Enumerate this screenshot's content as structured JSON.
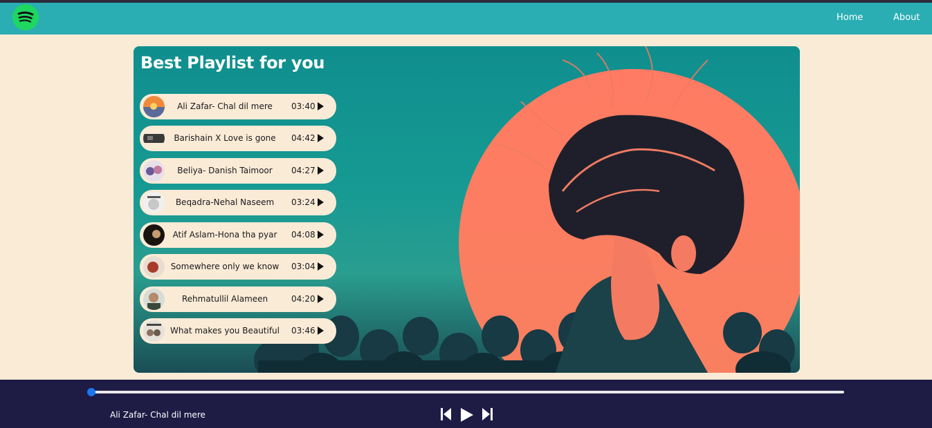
{
  "nav": {
    "logo_icon": "spotify-logo-icon",
    "home": "Home",
    "about": "About"
  },
  "playlist": {
    "heading": "Best Playlist for you",
    "songs": [
      {
        "title": "Ali Zafar- Chal dil mere",
        "duration": "03:40"
      },
      {
        "title": "Barishain X Love is gone",
        "duration": "04:42"
      },
      {
        "title": "Beliya- Danish Taimoor",
        "duration": "04:27"
      },
      {
        "title": "Beqadra-Nehal Naseem",
        "duration": "03:24"
      },
      {
        "title": "Atif Aslam-Hona tha pyar",
        "duration": "04:08"
      },
      {
        "title": "Somewhere only we know",
        "duration": "03:04"
      },
      {
        "title": "Rehmatullil Alameen",
        "duration": "04:20"
      },
      {
        "title": "What makes you Beautiful",
        "duration": "03:46"
      }
    ]
  },
  "player": {
    "now_playing": "Ali Zafar- Chal dil mere",
    "progress": 0,
    "icons": [
      "previous-icon",
      "play-icon",
      "next-icon"
    ]
  },
  "colors": {
    "navbar": "#2aaeb3",
    "page_bg": "#faebd7",
    "player_bg": "#1e1b45",
    "progress": "#1778f2",
    "logo": "#1ed760"
  }
}
